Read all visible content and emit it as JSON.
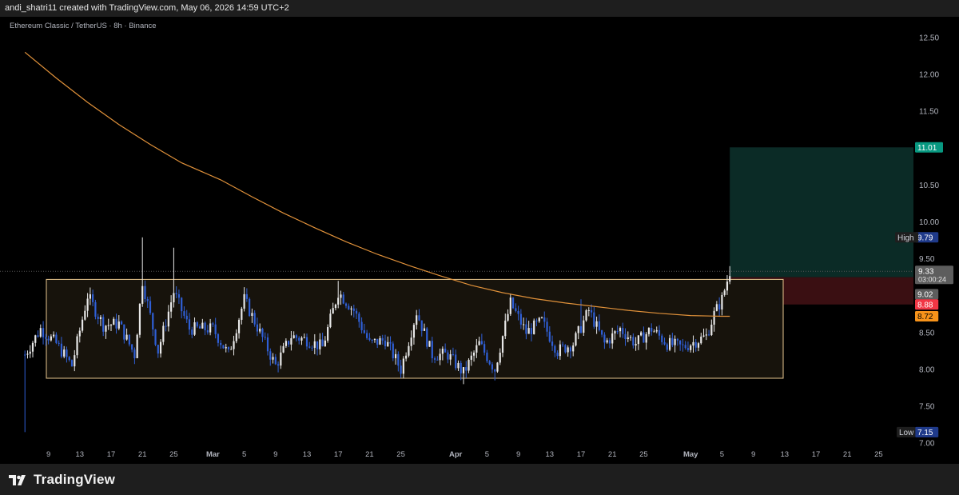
{
  "header": {
    "attribution": "andi_shatri11 created with TradingView.com, May 06, 2026 14:59 UTC+2"
  },
  "symbol_label": "Ethereum Classic / TetherUS · 8h · Binance",
  "brand": {
    "name": "TradingView",
    "icon": "tradingview-logo-icon"
  },
  "colors": {
    "background": "#000000",
    "bar": "#1e1e1e",
    "candle_up": "#e8e8e8",
    "candle_down": "#2f5fd6",
    "ma_line": "#e0913a",
    "range_box_border": "#e8c78f",
    "range_box_fill": "#17130c",
    "target_zone": "#0b2b26",
    "stop_zone": "#3a0f12"
  },
  "chart_data": {
    "type": "candlestick",
    "title": "Ethereum Classic / TetherUS · 8h · Binance",
    "ylim": [
      6.72,
      12.78
    ],
    "x_ticks": [
      "9",
      "13",
      "17",
      "21",
      "25",
      "Mar",
      "5",
      "9",
      "13",
      "17",
      "21",
      "25",
      "Apr",
      "5",
      "9",
      "13",
      "17",
      "21",
      "25",
      "May",
      "5",
      "9",
      "13",
      "17",
      "21",
      "25"
    ],
    "y_ticks": [
      "12.50",
      "12.00",
      "11.50",
      "11.01",
      "10.50",
      "10.00",
      "9.50",
      "8.50",
      "8.00",
      "7.50",
      "7.00"
    ],
    "price_labels": {
      "high": {
        "label": "High",
        "value": "9.79"
      },
      "low": {
        "label": "Low",
        "value": "7.15"
      },
      "last_price": "9.33",
      "countdown": "03:00:24",
      "level_1": "9.02",
      "level_2": "8.88",
      "level_3": "8.72",
      "target": "11.01"
    },
    "range_box": {
      "top": 9.22,
      "bottom": 7.88
    },
    "position_tool": {
      "entry": 9.25,
      "target": 11.01,
      "stop": 8.88
    },
    "moving_average": [
      [
        "Feb 6",
        12.3
      ],
      [
        "Feb 10",
        11.95
      ],
      [
        "Feb 14",
        11.62
      ],
      [
        "Feb 18",
        11.32
      ],
      [
        "Feb 22",
        11.05
      ],
      [
        "Feb 26",
        10.8
      ],
      [
        "Mar 2",
        10.57
      ],
      [
        "Mar 6",
        10.34
      ],
      [
        "Mar 10",
        10.12
      ],
      [
        "Mar 14",
        9.92
      ],
      [
        "Mar 18",
        9.73
      ],
      [
        "Mar 22",
        9.56
      ],
      [
        "Mar 26",
        9.41
      ],
      [
        "Mar 30",
        9.27
      ],
      [
        "Apr 3",
        9.14
      ],
      [
        "Apr 7",
        9.04
      ],
      [
        "Apr 11",
        8.96
      ],
      [
        "Apr 15",
        8.9
      ],
      [
        "Apr 19",
        8.85
      ],
      [
        "Apr 23",
        8.8
      ],
      [
        "Apr 27",
        8.76
      ],
      [
        "May 1",
        8.73
      ],
      [
        "May 5",
        8.72
      ],
      [
        "May 6",
        8.72
      ]
    ],
    "anchors": [
      [
        "Feb 6",
        8.2
      ],
      [
        "Feb 8",
        8.55
      ],
      [
        "Feb 10",
        8.35
      ],
      [
        "Feb 12",
        8.05
      ],
      [
        "Feb 14",
        9.0
      ],
      [
        "Feb 16",
        8.6
      ],
      [
        "Feb 18",
        8.62
      ],
      [
        "Feb 20",
        8.2
      ],
      [
        "Feb 21",
        9.2
      ],
      [
        "Feb 23",
        8.25
      ],
      [
        "Feb 25",
        9.05
      ],
      [
        "Feb 27",
        8.55
      ],
      [
        "Mar 1",
        8.55
      ],
      [
        "Mar 3",
        8.2
      ],
      [
        "Mar 5",
        8.95
      ],
      [
        "Mar 7",
        8.5
      ],
      [
        "Mar 9",
        8.05
      ],
      [
        "Mar 11",
        8.45
      ],
      [
        "Mar 13",
        8.4
      ],
      [
        "Mar 15",
        8.3
      ],
      [
        "Mar 17",
        9.05
      ],
      [
        "Mar 19",
        8.8
      ],
      [
        "Mar 21",
        8.35
      ],
      [
        "Mar 23",
        8.4
      ],
      [
        "Mar 25",
        8.0
      ],
      [
        "Mar 27",
        8.78
      ],
      [
        "Mar 29",
        8.2
      ],
      [
        "Mar 31",
        8.2
      ],
      [
        "Apr 2",
        7.95
      ],
      [
        "Apr 4",
        8.35
      ],
      [
        "Apr 6",
        8.0
      ],
      [
        "Apr 8",
        8.9
      ],
      [
        "Apr 10",
        8.5
      ],
      [
        "Apr 12",
        8.65
      ],
      [
        "Apr 14",
        8.25
      ],
      [
        "Apr 16",
        8.35
      ],
      [
        "Apr 18",
        8.8
      ],
      [
        "Apr 20",
        8.35
      ],
      [
        "Apr 22",
        8.55
      ],
      [
        "Apr 24",
        8.35
      ],
      [
        "Apr 26",
        8.55
      ],
      [
        "Apr 28",
        8.35
      ],
      [
        "Apr 30",
        8.3
      ],
      [
        "May 2",
        8.4
      ],
      [
        "May 3",
        8.45
      ],
      [
        "May 4",
        8.75
      ],
      [
        "May 5",
        8.95
      ],
      [
        "May 6",
        9.33
      ]
    ],
    "wick_spikes": [
      [
        "Feb 6",
        7.15
      ],
      [
        "Feb 21",
        9.79
      ],
      [
        "Feb 25",
        9.65
      ],
      [
        "Mar 17",
        9.2
      ],
      [
        "Apr 2",
        7.8
      ],
      [
        "Apr 6",
        7.85
      ],
      [
        "Apr 17",
        8.95
      ],
      [
        "May 6",
        9.4
      ]
    ]
  }
}
